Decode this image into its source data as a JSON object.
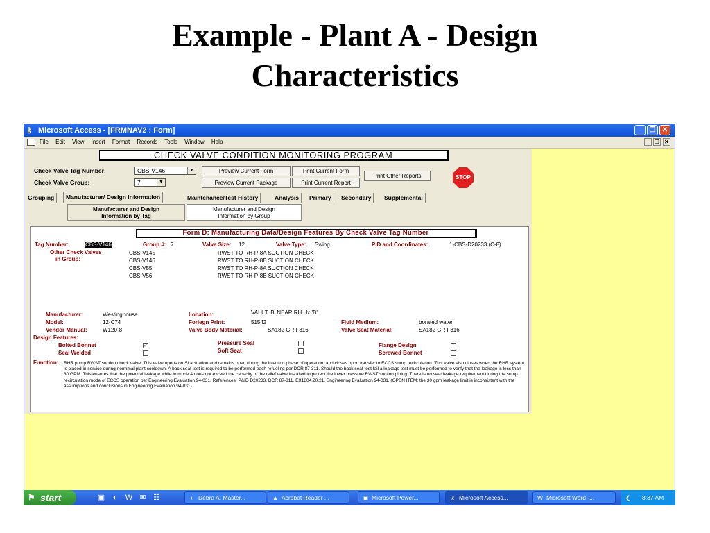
{
  "slide": {
    "title_line1": "Example - Plant A - Design",
    "title_line2": "Characteristics"
  },
  "window": {
    "title": "Microsoft Access - [FRMNAV2 : Form]",
    "minimize": "_",
    "maximize": "❐",
    "close": "✕"
  },
  "menu": [
    "File",
    "Edit",
    "View",
    "Insert",
    "Format",
    "Records",
    "Tools",
    "Window",
    "Help"
  ],
  "mdi_controls": {
    "min": "_",
    "restore": "❐",
    "close": "✕"
  },
  "program_title": "CHECK VALVE CONDITION MONITORING PROGRAM",
  "header": {
    "tag_label": "Check Valve Tag Number:",
    "tag_value": "CBS-V146",
    "group_label": "Check Valve Group:",
    "group_value": "7",
    "btn_preview_form": "Preview Current Form",
    "btn_print_form": "Print Current Form",
    "btn_preview_package": "Preview Current Package",
    "btn_print_report": "Print Current Report",
    "btn_other_reports": "Print Other Reports",
    "stop": "STOP"
  },
  "tabs": [
    "Grouping",
    "Manufacturer/ Design Information",
    "Maintenance/Test History",
    "Analysis",
    "Primary",
    "Secondary",
    "Supplemental"
  ],
  "subtabs": {
    "by_tag_line1": "Manufacturer and Design",
    "by_tag_line2": "Information by Tag",
    "by_group_line1": "Manufacturer and Design",
    "by_group_line2": "Information by Group"
  },
  "form_d": {
    "title": "Form D:  Manufacturing Data/Design Features By Check Valve Tag Number",
    "tag_label": "Tag Number:",
    "tag_value": "CBS-V146",
    "group_label": "Group #:",
    "group_value": "7",
    "size_label": "Valve Size:",
    "size_value": "12",
    "type_label": "Valve Type:",
    "type_value": "Swing",
    "pid_label": "PID and Coordinates:",
    "pid_value": "1-CBS-D20233 (C-8)",
    "other_label_1": "Other Check Valves",
    "other_label_2": "in Group:",
    "other_valves": [
      {
        "tag": "CBS-V145",
        "desc": "RWST TO RH-P-8A SUCTION CHECK"
      },
      {
        "tag": "CBS-V146",
        "desc": "RWST TO RH-P-8B SUCTION CHECK"
      },
      {
        "tag": "CBS-V55",
        "desc": "RWST TO RH-P-8A SUCTION CHECK"
      },
      {
        "tag": "CBS-V56",
        "desc": "RWST TO RH-P-8B SUCTION CHECK"
      }
    ],
    "manufacturer_label": "Manufacturer:",
    "manufacturer_value": "Westinghouse",
    "location_label": "Location:",
    "location_value": "VAULT 'B' NEAR RH Hx 'B'",
    "model_label": "Model:",
    "model_value": "12-C74",
    "foreign_label": "Foriegn Print:",
    "foreign_value": "51542",
    "fluid_label": "Fluid Medium:",
    "fluid_value": "borated water",
    "vendor_label": "Vendor Manual:",
    "vendor_value": "W120-8",
    "body_label": "Valve Body Material:",
    "body_value": "SA182 GR F316",
    "seat_label": "Valve Seat Material:",
    "seat_value": "SA182 GR F316",
    "design_label": "Design Features:",
    "bolted_label": "Bolted Bonnet",
    "bolted_check": "✓",
    "pressure_label": "Pressure Seal",
    "flange_label": "Flange Design",
    "seal_label": "Seal Welded",
    "soft_label": "Soft Seat",
    "screwed_label": "Screwed Bonnet",
    "function_label": "Function:",
    "function_text": "RHR pump RWST suction check valve. This valve  opens on SI actuation and remains open during the injection phase of operation, and closes upon transfer to ECCS sump recirculation. This valve also closes when the RHR system is placed in service during normmal plant cooldown. A back seat test is required to be performed each refueling per DCR 87-311. Should the back seat test fail a leakage test must be performed to verify that the leakage is less than 30 GPM. This ensures that the potential leakage while in mode 4 does not exceed the capacity of the relief valve installed to protect the lower pressure RWST suction piping. There is no seat leakage requirement during the sump recirculation mode of ECCS operation per Engineering Evaluation 94-031.  References: P&ID D20233, DCR 87-311, EX1804.20,21, Engineering Evaluation 94-031. (OPEN ITEM: the 30 gpm leakage limit is inconsistent with  the assumptions and conclusions in Engineering Evaluation 94-031)"
  },
  "taskbar": {
    "start": "start",
    "tasks": [
      "Debra A. Master...",
      "Acrobat Reader ...",
      "Microsoft Power...",
      "Microsoft Access...",
      "Microsoft Word -..."
    ],
    "time": "8:37 AM"
  }
}
